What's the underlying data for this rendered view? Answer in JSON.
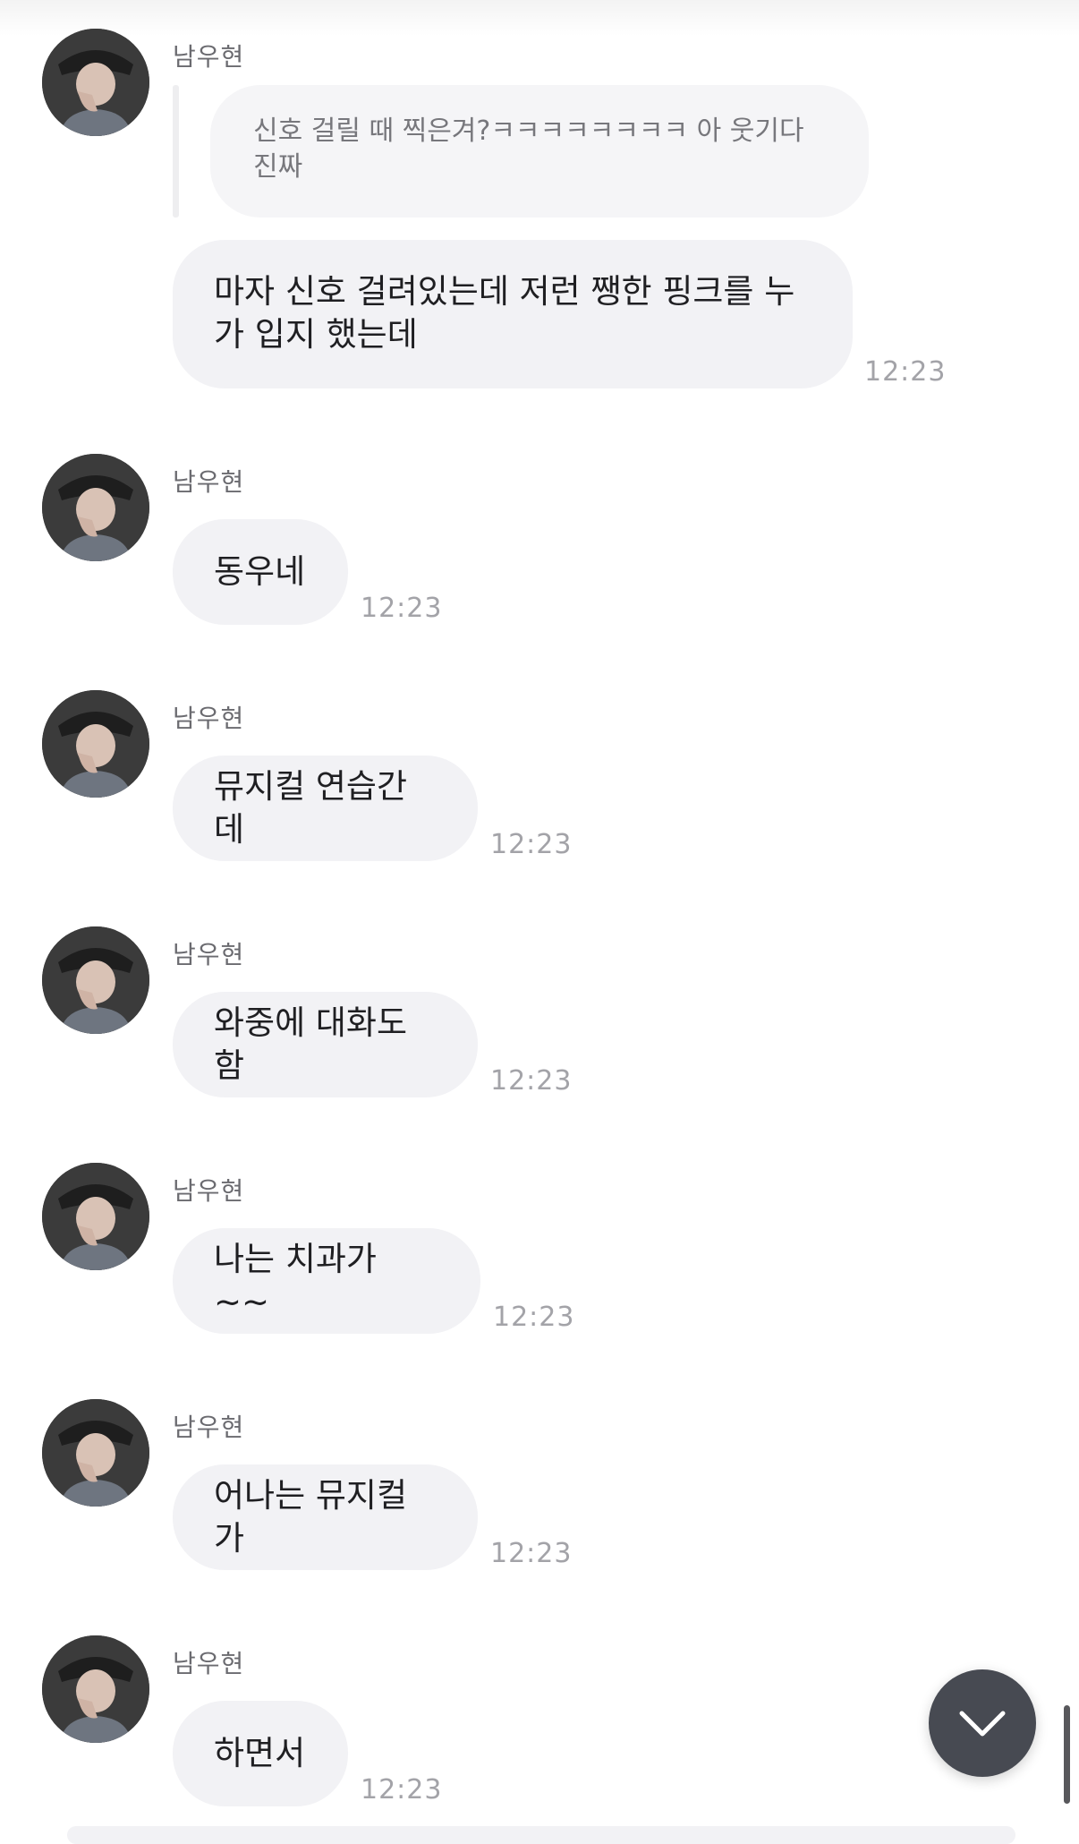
{
  "chat": {
    "sender_name": "남우현",
    "reply_quote": "신호 걸릴 때 찍은겨?ㅋㅋㅋㅋㅋㅋㅋㅋ 아 웃기다 진짜",
    "messages": [
      {
        "text": "마자 신호 걸려있는데 저런 쨍한 핑크를 누가 입지 했는데",
        "time": "12:23"
      },
      {
        "text": "동우네",
        "time": "12:23"
      },
      {
        "text": "뮤지컬 연습간데",
        "time": "12:23"
      },
      {
        "text": "와중에 대화도함",
        "time": "12:23"
      },
      {
        "text": "나는 치과가 ~~",
        "time": "12:23"
      },
      {
        "text": "어나는 뮤지컬가",
        "time": "12:23"
      },
      {
        "text": "하면서",
        "time": "12:23"
      }
    ]
  },
  "icons": {
    "scroll_down": "chevron-down-icon",
    "avatar": "profile-photo"
  },
  "colors": {
    "bubble": "#f2f2f5",
    "fab": "#474a52",
    "time_text": "#a3a3a8",
    "sender_text": "#6b6b70"
  }
}
